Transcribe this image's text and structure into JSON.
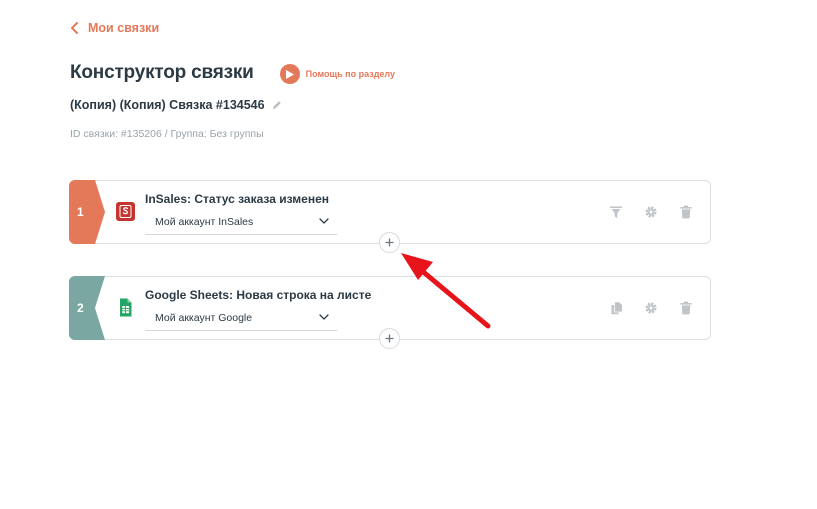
{
  "nav": {
    "back_label": "Мои связки"
  },
  "header": {
    "title": "Конструктор связки",
    "help_label": "Помощь по разделу",
    "connection_name": "(Копия) (Копия) Связка #134546",
    "meta": "ID связки: #135206 / Группа: Без группы"
  },
  "steps": [
    {
      "number": "1",
      "title": "InSales: Статус заказа изменен",
      "account": "Мой аккаунт InSales",
      "icon": "insales-icon",
      "actions": [
        "filter-icon",
        "gear-icon",
        "trash-icon"
      ]
    },
    {
      "number": "2",
      "title": "Google Sheets: Новая строка на листе",
      "account": "Мой аккаунт Google",
      "icon": "google-sheets-icon",
      "actions": [
        "copy-icon",
        "gear-icon",
        "trash-icon"
      ]
    }
  ],
  "colors": {
    "accent": "#e4795a",
    "step2": "#7aa7a1",
    "text": "#2b3a44",
    "muted": "#9aa3aa",
    "annotation_arrow": "#e8141b"
  }
}
